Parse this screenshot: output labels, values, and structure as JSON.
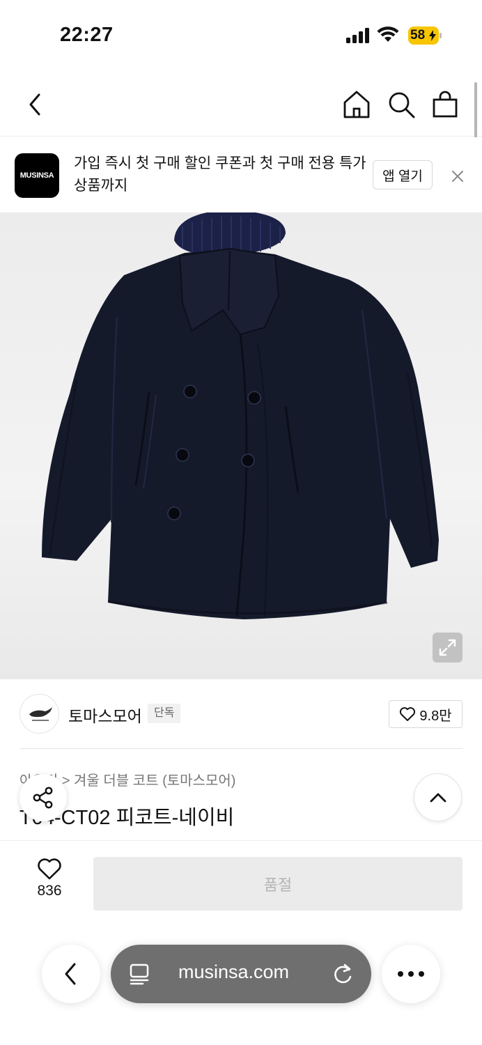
{
  "status_bar": {
    "time": "22:27",
    "battery": "58"
  },
  "nav": {
    "back": "back",
    "home": "home",
    "search": "search",
    "cart": "cart"
  },
  "app_banner": {
    "logo_text": "MUSINSA",
    "message": "가입 즉시 첫 구매 할인 쿠폰과 첫 구매 전용 특가 상품까지",
    "open_app_label": "앱 열기"
  },
  "brand": {
    "name": "토마스모어",
    "badge": "단독",
    "likes": "9.8만"
  },
  "product": {
    "breadcrumb_prefix": "아우터",
    "breadcrumb_sep": ">",
    "breadcrumb_category": "겨울 더블 코트 (토마스모어)",
    "title": "T04-CT02 피코트-네이비"
  },
  "purchase": {
    "wish_count": "836",
    "soldout_label": "품절"
  },
  "browser": {
    "url": "musinsa.com"
  },
  "colors": {
    "coat": "#151a2b",
    "soldout_bg": "#ebebeb",
    "address_pill": "#6f6f6f",
    "battery": "#f7c600"
  }
}
